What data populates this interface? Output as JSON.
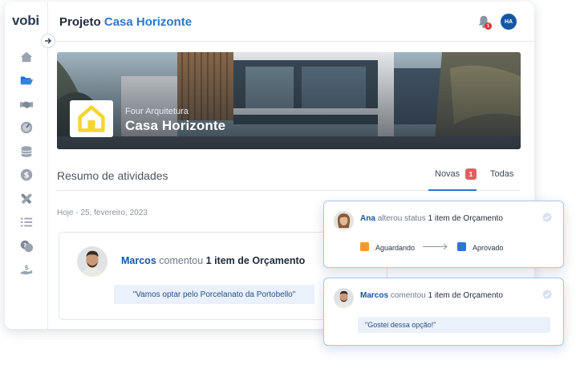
{
  "sidebar": {
    "logo": "vobi",
    "items": [
      {
        "icon": "home-icon"
      },
      {
        "icon": "folder-open-icon"
      },
      {
        "icon": "handshake-icon"
      },
      {
        "icon": "gauge-icon"
      },
      {
        "icon": "coins-icon"
      },
      {
        "icon": "dollar-icon"
      },
      {
        "icon": "tools-icon"
      },
      {
        "icon": "list-icon"
      },
      {
        "icon": "chat-question-icon"
      },
      {
        "icon": "hand-money-icon"
      }
    ]
  },
  "header": {
    "title_prefix": "Projeto",
    "title_project": "Casa Horizonte",
    "notification_count": "1",
    "avatar_initials": "HA"
  },
  "hero": {
    "subtitle": "Four Arquitetura",
    "title": "Casa Horizonte",
    "brand_color": "#f5d530"
  },
  "activity": {
    "section_title": "Resumo de atividades",
    "tabs": [
      {
        "label": "Novas",
        "badge": "1",
        "active": true
      },
      {
        "label": "Todas",
        "active": false
      }
    ],
    "date_label": "Hoje - 25, fevereiro, 2023",
    "main_card": {
      "name": "Marcos",
      "verb": "comentou",
      "object": "1 item de Orçamento",
      "quote": "\"Vamos optar pelo Porcelanato da Portobello\""
    }
  },
  "notifications": [
    {
      "name": "Ana",
      "verb": "alterou status",
      "object": "1 item de Orçamento",
      "from_status": "Aguardando",
      "to_status": "Aprovado",
      "from_color": "#f39a2c",
      "to_color": "#2f74d0"
    },
    {
      "name": "Marcos",
      "verb": "comentou",
      "object": "1 item de Orçamento",
      "quote": "\"Gostei dessa opção!\""
    }
  ],
  "colors": {
    "accent": "#2c78c9",
    "name_blue": "#1557a3",
    "badge_red": "#e06060"
  }
}
